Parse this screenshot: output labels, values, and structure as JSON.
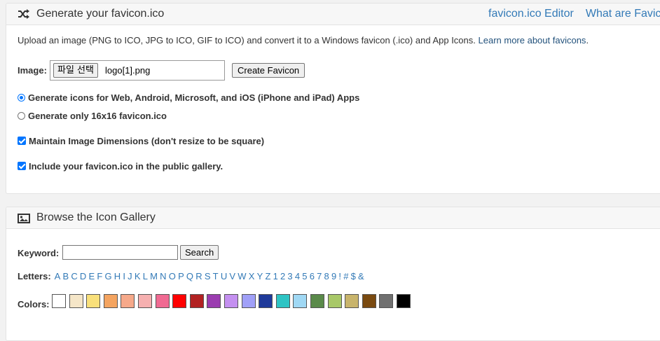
{
  "generator": {
    "title": "Generate your favicon.ico",
    "icon": "shuffle-icon",
    "links": [
      "favicon.ico Editor",
      "What are Favicons?"
    ],
    "intro_text": "Upload an image (PNG to ICO, JPG to ICO, GIF to ICO) and convert it to a Windows favicon (.ico) and App Icons. ",
    "intro_link": "Learn more about favicons",
    "intro_end": ".",
    "image_label": "Image:",
    "file_button": "파일 선택",
    "file_name": "logo[1].png",
    "create_button": "Create Favicon",
    "radio_all": "Generate icons for Web, Android, Microsoft, and iOS (iPhone and iPad) Apps",
    "radio_only": "Generate only 16x16 favicon.ico",
    "check_dimensions": "Maintain Image Dimensions (don't resize to be square)",
    "check_gallery": "Include your favicon.ico in the public gallery."
  },
  "gallery": {
    "title": "Browse the Icon Gallery",
    "icon": "image-icon",
    "keyword_label": "Keyword:",
    "search_button": "Search",
    "letters_label": "Letters:",
    "letters": [
      "A",
      "B",
      "C",
      "D",
      "E",
      "F",
      "G",
      "H",
      "I",
      "J",
      "K",
      "L",
      "M",
      "N",
      "O",
      "P",
      "Q",
      "R",
      "S",
      "T",
      "U",
      "V",
      "W",
      "X",
      "Y",
      "Z",
      "1",
      "2",
      "3",
      "4",
      "5",
      "6",
      "7",
      "8",
      "9",
      "!",
      "#",
      "$",
      "&"
    ],
    "colors_label": "Colors:",
    "colors": [
      "#ffffff",
      "#f5e6c8",
      "#f9e07a",
      "#f4a460",
      "#f6a98a",
      "#f6b0b0",
      "#f06a92",
      "#ff0000",
      "#b22222",
      "#9b3db0",
      "#c490f0",
      "#a0a0f8",
      "#1f3a9a",
      "#2ec4c4",
      "#a0d8f4",
      "#5a8a4a",
      "#a8c868",
      "#c8b46c",
      "#7a4a10",
      "#707070",
      "#000000"
    ]
  }
}
